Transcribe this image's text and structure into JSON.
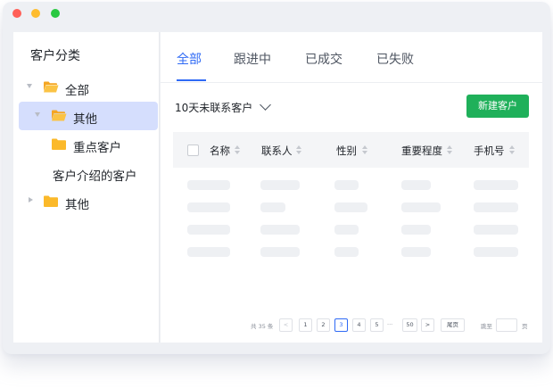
{
  "window": {
    "controls": {
      "close_color": "#ff5f57",
      "minimize_color": "#febc2e",
      "maximize_color": "#28c840"
    }
  },
  "sidebar": {
    "title": "客户分类",
    "tree": [
      {
        "label": "全部",
        "icon": "folder-open-icon",
        "expanded": true
      },
      {
        "label": "其他",
        "icon": "folder-open-icon",
        "expanded": true,
        "selected": true
      },
      {
        "label": "重点客户",
        "icon": "folder-icon"
      },
      {
        "label": "客户介绍的客户",
        "icon": "none"
      },
      {
        "label": "其他",
        "icon": "folder-icon",
        "expanded": false
      }
    ]
  },
  "tabs": [
    {
      "label": "全部",
      "active": true
    },
    {
      "label": "跟进中"
    },
    {
      "label": "已成交"
    },
    {
      "label": "已失败"
    }
  ],
  "toolbar": {
    "filter_label": "10天未联系客户",
    "new_button_label": "新建客户"
  },
  "table": {
    "columns": [
      "名称",
      "联系人",
      "性别",
      "重要程度",
      "手机号"
    ],
    "loading": true,
    "skeleton_rows": 4
  },
  "pagination": {
    "total_text": "共 35 条",
    "prev": "<",
    "pages": [
      "1",
      "2",
      "3",
      "4",
      "5"
    ],
    "current_page": "3",
    "ellipsis": "···",
    "last_page": "50",
    "next": ">",
    "tail_label": "尾页",
    "jump_label": "跳至",
    "jump_value": "",
    "page_unit": "页"
  },
  "colors": {
    "accent": "#2f6af5",
    "selected_bg": "#d5defd",
    "primary_button": "#1fb05a",
    "folder": "#fbb92a"
  }
}
